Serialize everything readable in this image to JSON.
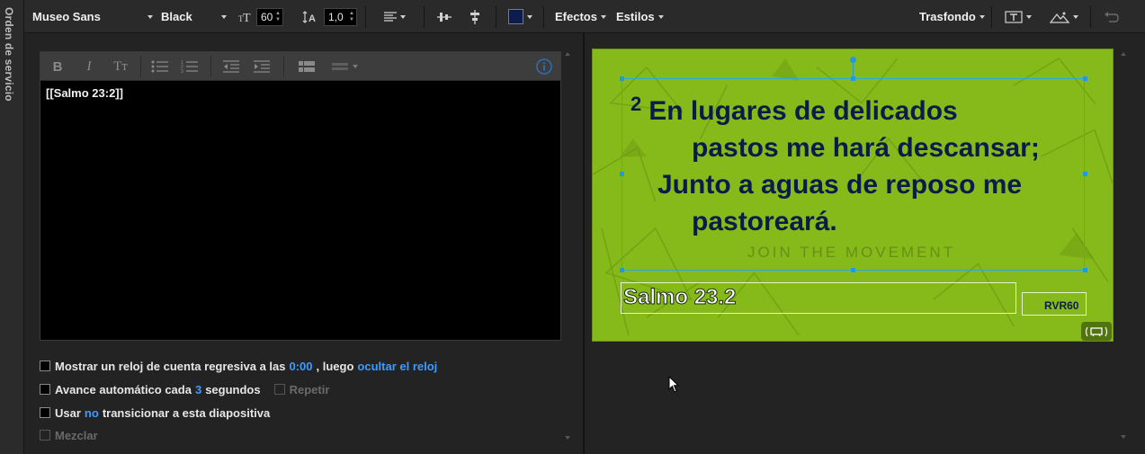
{
  "sidebar": {
    "tab_label": "Orden de servicio"
  },
  "toolbar": {
    "font_family": "Museo Sans",
    "font_weight": "Black",
    "font_size": "60",
    "line_spacing": "1,0",
    "text_color": "#0d1b4d",
    "effects_label": "Efectos",
    "styles_label": "Estilos",
    "background_label": "Trasfondo",
    "icons": [
      "font-size-icon",
      "line-height-icon",
      "align-left-icon",
      "align-center-vertical-icon",
      "align-center-horizontal-icon",
      "text-box-icon",
      "image-icon",
      "undo-icon"
    ]
  },
  "editor": {
    "toolbar_icons": [
      "bold-icon",
      "italic-icon",
      "text-case-icon",
      "bullet-list-icon",
      "numbered-list-icon",
      "outdent-icon",
      "indent-icon",
      "table-icon",
      "layout-icon",
      "info-icon"
    ],
    "bold": "B",
    "italic": "I",
    "case": "Tт",
    "content": "[[Salmo 23:2]]"
  },
  "options": {
    "countdown": {
      "prefix": "Mostrar un reloj de cuenta regresiva a las",
      "time": "0:00",
      "middle": ", luego",
      "action": "ocultar el reloj"
    },
    "auto_advance": {
      "prefix": "Avance automático cada",
      "seconds": "3",
      "suffix": "segundos",
      "repeat": "Repetir"
    },
    "transition": {
      "prefix": "Usar",
      "value": "no",
      "suffix": "transicionar a esta diapositiva"
    },
    "shuffle": "Mezclar"
  },
  "slide": {
    "verse_number": "2",
    "lines": [
      "En lugares de delicados",
      "pastos me hará descansar;",
      "Junto a aguas de reposo me",
      "pastoreará."
    ],
    "watermark": "JOIN THE MOVEMENT",
    "reference": "Salmo 23.2",
    "version": "RVR60",
    "background_color": "#86b91a"
  }
}
